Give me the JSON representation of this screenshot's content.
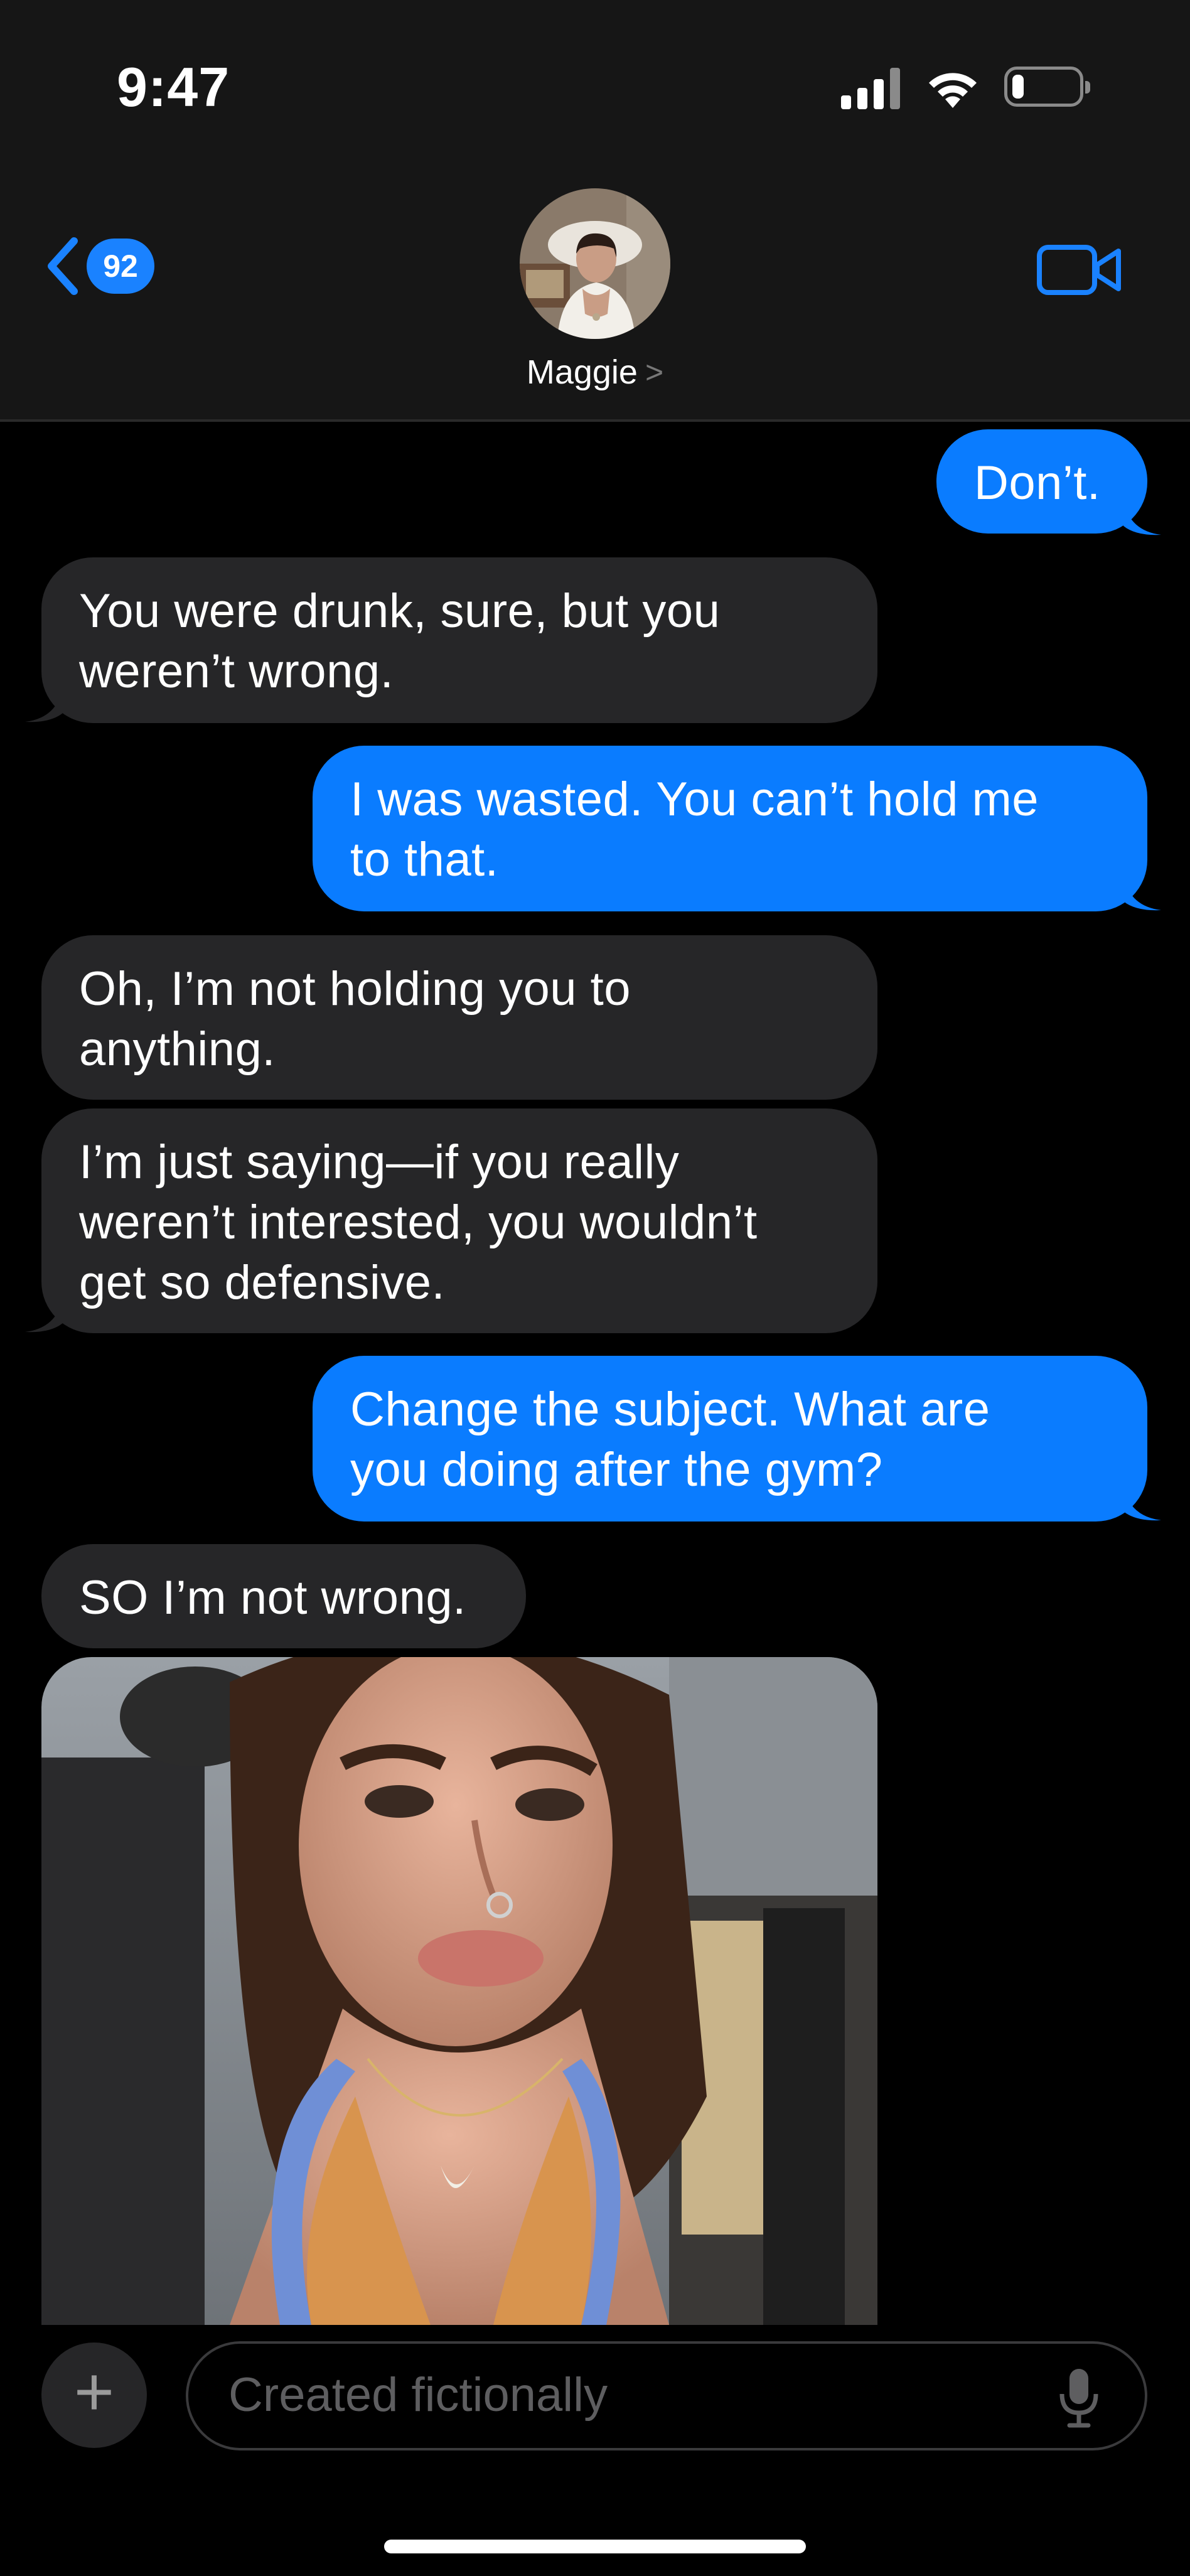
{
  "status_bar": {
    "time": "9:47",
    "battery_level": 0.2
  },
  "header": {
    "unread_count": "92",
    "contact_name": "Maggie",
    "contact_chevron": ">",
    "back_icon": "chevron-left-icon",
    "video_icon": "video-camera-icon"
  },
  "messages": [
    {
      "side": "outgoing",
      "text": "Don’t."
    },
    {
      "side": "incoming",
      "text": "You were drunk, sure, but you\nweren’t wrong."
    },
    {
      "side": "outgoing",
      "text": "I was wasted. You can’t hold me\nto that."
    },
    {
      "side": "incoming",
      "text": "Oh, I’m not holding you to\nanything."
    },
    {
      "side": "incoming",
      "text": "I’m just saying—if you really\nweren’t interested, you wouldn’t\nget so defensive."
    },
    {
      "side": "outgoing",
      "text": "Change the subject. What are\nyou doing after the gym?"
    },
    {
      "side": "incoming",
      "text": "SO I’m not wrong."
    },
    {
      "side": "incoming",
      "type": "photo"
    }
  ],
  "composer": {
    "plus_label": "+",
    "placeholder": "Created fictionally",
    "mic_icon": "microphone-icon"
  },
  "colors": {
    "outgoing_bubble": "#0a7cff",
    "incoming_bubble": "#262628",
    "accent": "#1a82ff",
    "background": "#000000"
  }
}
